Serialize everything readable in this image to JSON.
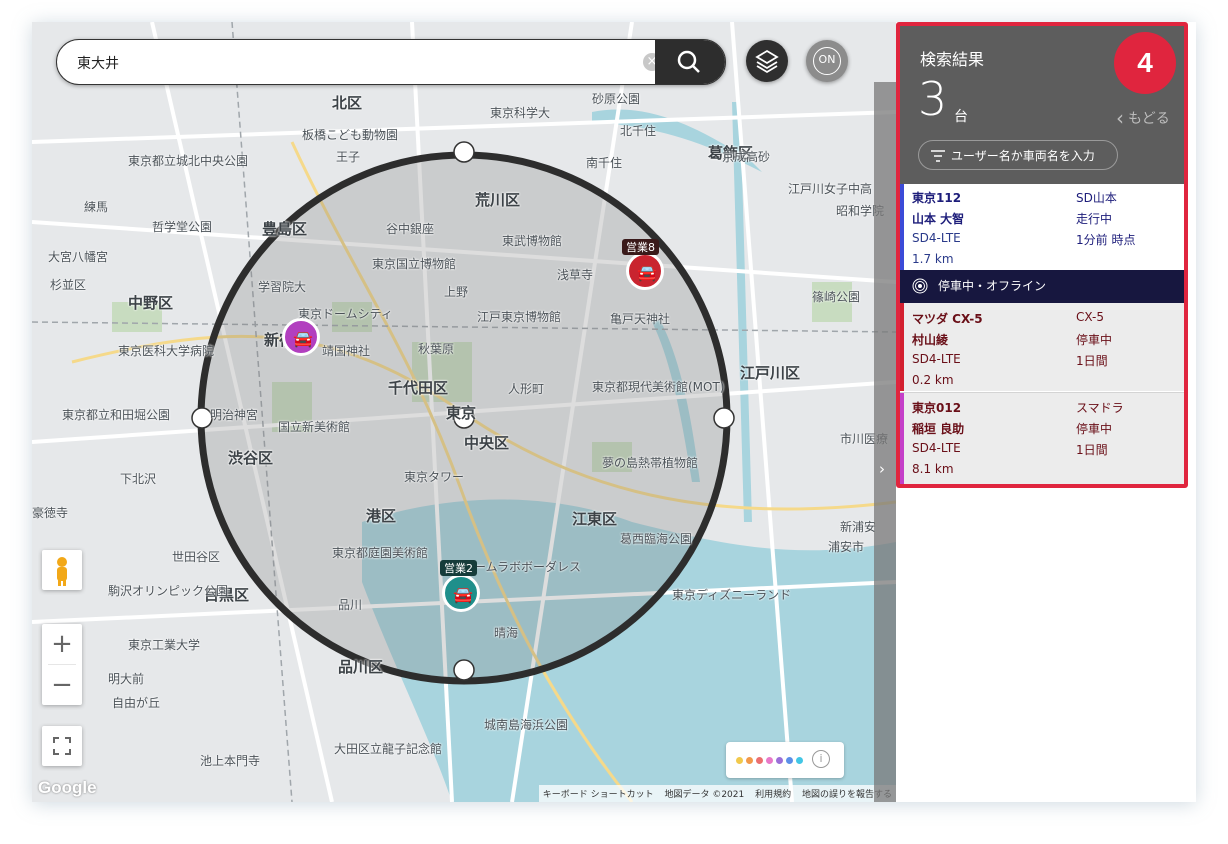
{
  "search": {
    "value": "東大井",
    "clear": "×"
  },
  "map_buttons": {
    "on_label": "ON"
  },
  "map_labels": [
    "北区",
    "板橋こども動物園",
    "荒川区",
    "豊島区",
    "谷中銀座",
    "東京国立博物館",
    "東武博物館",
    "浅草寺",
    "学習院大",
    "東京ドームシティ",
    "江戸東京博物館",
    "亀戸天神社",
    "新宿",
    "靖国神社",
    "秋葉原",
    "上野",
    "千代田区",
    "中央区",
    "東京",
    "人形町",
    "東京都現代美術館(MOT)",
    "中野区",
    "杉並区",
    "渋谷区",
    "国立新美術館",
    "明治神宮",
    "港区",
    "東京タワー",
    "江東区",
    "夢の島熱帯植物館",
    "目黒区",
    "世田谷区",
    "東京都庭園美術館",
    "チームラボボーダレス",
    "品川区",
    "大田区立龍子記念館",
    "城南島海浜公園",
    "晴海",
    "東京ディズニーランド",
    "江戸川区",
    "葛飾区",
    "京成高砂",
    "葛西臨海公園",
    "練馬",
    "東京医科大学病院",
    "東京都立和田堀公園",
    "駒沢オリンピック公園",
    "東京工業大学",
    "篠崎公園",
    "浦安市",
    "市川医療",
    "新浦安",
    "砂原公園",
    "南千住",
    "北千住",
    "王子",
    "東京都立城北中央公園",
    "哲学堂公園",
    "大宮八幡宮",
    "下北沢",
    "豪徳寺",
    "明大前",
    "自由が丘",
    "池上本門寺",
    "品川",
    "東京科学大",
    "江戸川女子中高",
    "昭和学院"
  ],
  "markers": [
    {
      "label": "営業8",
      "color": "#c9242f"
    },
    {
      "label": "営業2",
      "color": "#1f8f8b"
    },
    {
      "label": "",
      "color": "#b23fbf"
    }
  ],
  "legend": {
    "colors": [
      "#f2c94c",
      "#f2994a",
      "#eb6f6f",
      "#e879c9",
      "#9b6fd8",
      "#5b8fe8",
      "#42c6e5"
    ],
    "info": "i"
  },
  "attribution": {
    "google": "Google",
    "items": [
      "キーボード ショートカット",
      "地図データ ©2021",
      "利用規約",
      "地図の誤りを報告する"
    ]
  },
  "panel": {
    "title": "検索結果",
    "count": "3",
    "unit": "台",
    "badge": "4",
    "back": "もどる",
    "filter_placeholder": "ユーザー名か車両名を入力",
    "offline_label": "停車中・オフライン",
    "vehicles": [
      {
        "name": "東京112",
        "model": "SD山本",
        "user": "山本 大智",
        "status": "走行中",
        "device": "SD4-LTE",
        "time": "1分前 時点",
        "distance": "1.7 km",
        "color": "#3b4bd8"
      },
      {
        "name": "マツダ CX-5",
        "model": "CX-5",
        "user": "村山綾",
        "status": "停車中",
        "device": "SD4-LTE",
        "time": "1日間",
        "distance": "0.2 km",
        "color": "#d31f2f"
      },
      {
        "name": "東京012",
        "model": "スマドラ",
        "user": "稲垣 良助",
        "status": "停車中",
        "device": "SD4-LTE",
        "time": "1日間",
        "distance": "8.1 km",
        "color": "#c43fc8"
      }
    ]
  }
}
